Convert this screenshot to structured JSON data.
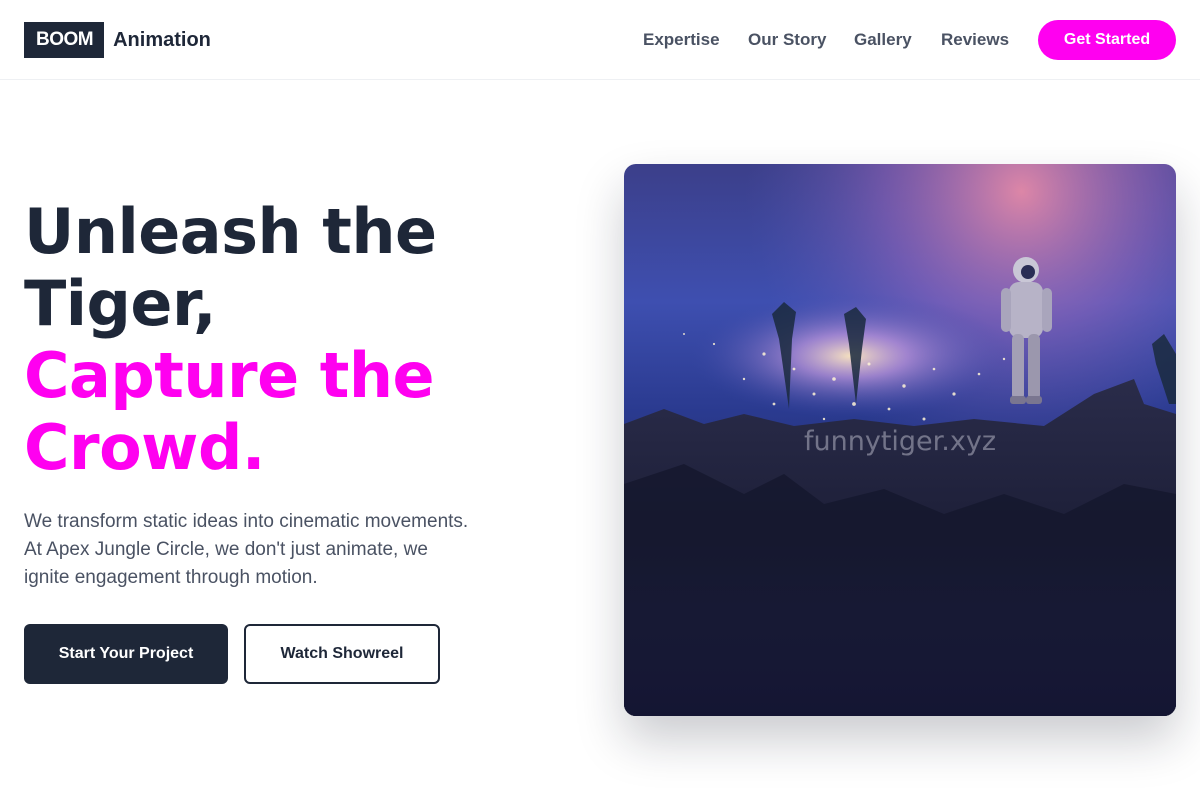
{
  "header": {
    "logo_box": "BOOM",
    "logo_text": "Animation",
    "nav": [
      {
        "label": "Expertise"
      },
      {
        "label": "Our Story"
      },
      {
        "label": "Gallery"
      },
      {
        "label": "Reviews"
      }
    ],
    "cta_label": "Get Started"
  },
  "hero": {
    "headline": {
      "line1": "Unleash the",
      "line2": "Tiger,",
      "line3": "Capture the",
      "line4": "Crowd."
    },
    "description": {
      "line1": "We transform static ideas into cinematic movements.",
      "line2": "At Apex Jungle Circle, we don't just animate, we",
      "line3": "ignite engagement through motion."
    },
    "primary_button": "Start Your Project",
    "secondary_button": "Watch Showreel",
    "image": {
      "watermark": "funnytiger.xyz",
      "subject": "astronaut-on-cliff-above-city-lights"
    }
  },
  "colors": {
    "brand_dark": "#1e2738",
    "accent": "#ff00f0",
    "body_text": "#4a5263"
  }
}
